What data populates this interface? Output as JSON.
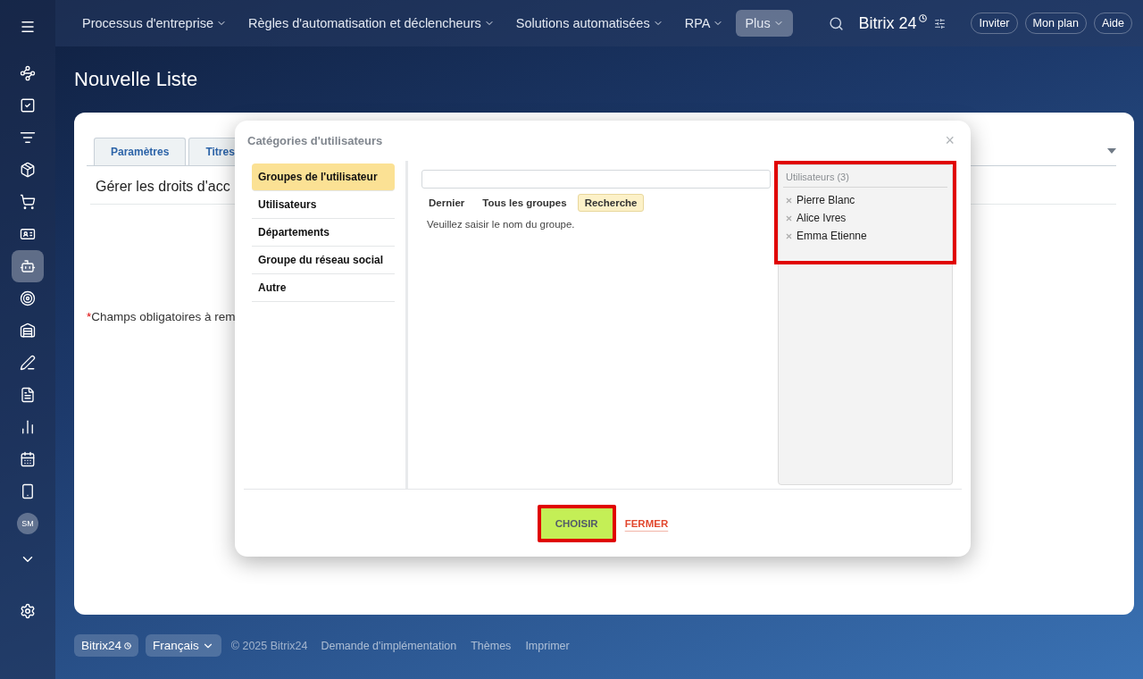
{
  "sidebar": {
    "items": [
      {
        "selected": false
      },
      {
        "selected": false
      },
      {
        "selected": false
      },
      {
        "selected": false
      },
      {
        "selected": false
      },
      {
        "selected": false
      },
      {
        "selected": true
      },
      {
        "selected": false
      },
      {
        "selected": false
      },
      {
        "selected": false
      },
      {
        "selected": false
      },
      {
        "selected": false
      },
      {
        "selected": false
      },
      {
        "selected": false
      }
    ],
    "avatar": "SM"
  },
  "top_nav": [
    {
      "label": "Processus d'entreprise",
      "selected": false
    },
    {
      "label": "Règles d'automatisation et déclencheurs",
      "selected": false
    },
    {
      "label": "Solutions automatisées",
      "selected": false
    },
    {
      "label": "RPA",
      "selected": false
    },
    {
      "label": "Plus",
      "selected": true
    }
  ],
  "logo": {
    "name": "Bitrix",
    "number": "24"
  },
  "header_buttons": [
    "Inviter",
    "Mon plan",
    "Aide"
  ],
  "page_title": "Nouvelle Liste",
  "card": {
    "tabs": [
      {
        "label": "Paramètres",
        "selected": false
      },
      {
        "label": "Titres",
        "selected": false
      }
    ],
    "section_title": "Gérer les droits d'acc",
    "required_mark": "*",
    "required_note": "Champs obligatoires à rem"
  },
  "dialog": {
    "title": "Catégories d'utilisateurs",
    "close": "×",
    "categories": [
      {
        "label": "Groupes de l'utilisateur",
        "selected": true
      },
      {
        "label": "Utilisateurs",
        "selected": false
      },
      {
        "label": "Départements",
        "selected": false
      },
      {
        "label": "Groupe du réseau social",
        "selected": false
      },
      {
        "label": "Autre",
        "selected": false
      }
    ],
    "search_tabs": [
      {
        "label": "Dernier",
        "selected": false
      },
      {
        "label": "Tous les groupes",
        "selected": false
      },
      {
        "label": "Recherche",
        "selected": true
      }
    ],
    "hint": "Veuillez saisir le nom du groupe.",
    "selected_panel": {
      "title": "Utilisateurs (3)",
      "highlighted": true,
      "items": [
        "Pierre Blanc",
        "Alice Ivres",
        "Emma Etienne"
      ]
    },
    "buttons": [
      {
        "label": "CHOISIR",
        "kind": "primary",
        "highlighted": true
      },
      {
        "label": "FERMER",
        "kind": "link",
        "highlighted": false
      }
    ]
  },
  "footer": {
    "logo": "Bitrix24",
    "language": "Français",
    "copyright": "© 2025 Bitrix24",
    "links": [
      "Demande d'implémentation",
      "Thèmes",
      "Imprimer"
    ]
  }
}
